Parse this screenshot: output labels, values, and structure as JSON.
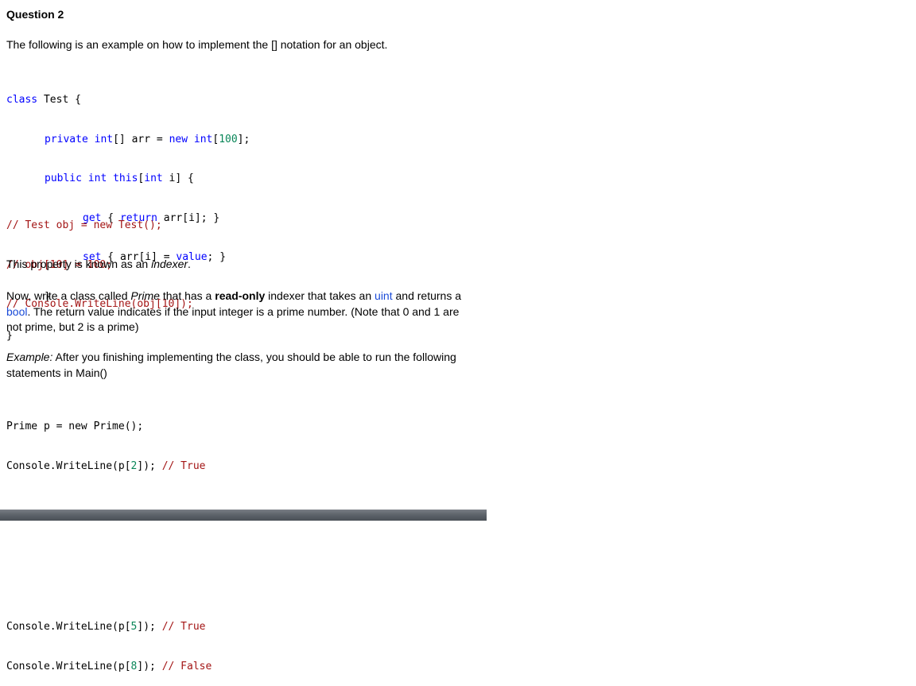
{
  "heading": "Question 2",
  "intro": "The following is an example on how to implement the [] notation for an object.",
  "code1": {
    "l1_kw": "class",
    "l1_rest": " Test {",
    "l2_private": "private",
    "l2_int": " int",
    "l2_a": "[] arr = ",
    "l2_new": "new",
    "l2_int2": " int",
    "l2_b": "[",
    "l2_num": "100",
    "l2_c": "];",
    "l3_public": "public",
    "l3_int": " int",
    "l3_this": " this",
    "l3_b": "[",
    "l3_int2": "int",
    "l3_c": " i] {",
    "l4_get": "get",
    "l4_a": " { ",
    "l4_return": "return",
    "l4_b": " arr[i]; }",
    "l5_set": "set",
    "l5_a": " { arr[i] = ",
    "l5_value": "value",
    "l5_b": "; }",
    "l6": "}",
    "l7": "}"
  },
  "comments": [
    "// Test obj = new Test();",
    "// obj[10] = 100;",
    "// Console.WriteLine(obj[10]);"
  ],
  "indexer_sentence": {
    "before": "This property is known as an ",
    "em": "indexer",
    "after": "."
  },
  "task": {
    "p1": "Now, write a class called ",
    "prime": "Prime",
    "p2": " that has a ",
    "readonly": "read-only",
    "p3": " indexer that takes an ",
    "uint": "uint",
    "p4": " and returns a",
    "bool": "bool",
    "p5": ". The return value indicates if the input integer is a prime number. (Note that 0 and 1 are",
    "p6": "not prime, but 2 is a prime)"
  },
  "example": {
    "label": "Example:",
    "text1": " After you finishing implementing the class, you should be able to run the following",
    "text2": "statements in Main()"
  },
  "code2": {
    "l1": "Prime p = new Prime();",
    "l2_a": "Console.WriteLine(p[",
    "l2_num": "2",
    "l2_b": "]); ",
    "l2_cm": "// True"
  },
  "code3": {
    "l1_a": "Console.WriteLine(p[",
    "l1_num": "5",
    "l1_b": "]); ",
    "l1_cm": "// True",
    "l2_a": "Console.WriteLine(p[",
    "l2_num": "8",
    "l2_b": "]); ",
    "l2_cm": "// False"
  }
}
